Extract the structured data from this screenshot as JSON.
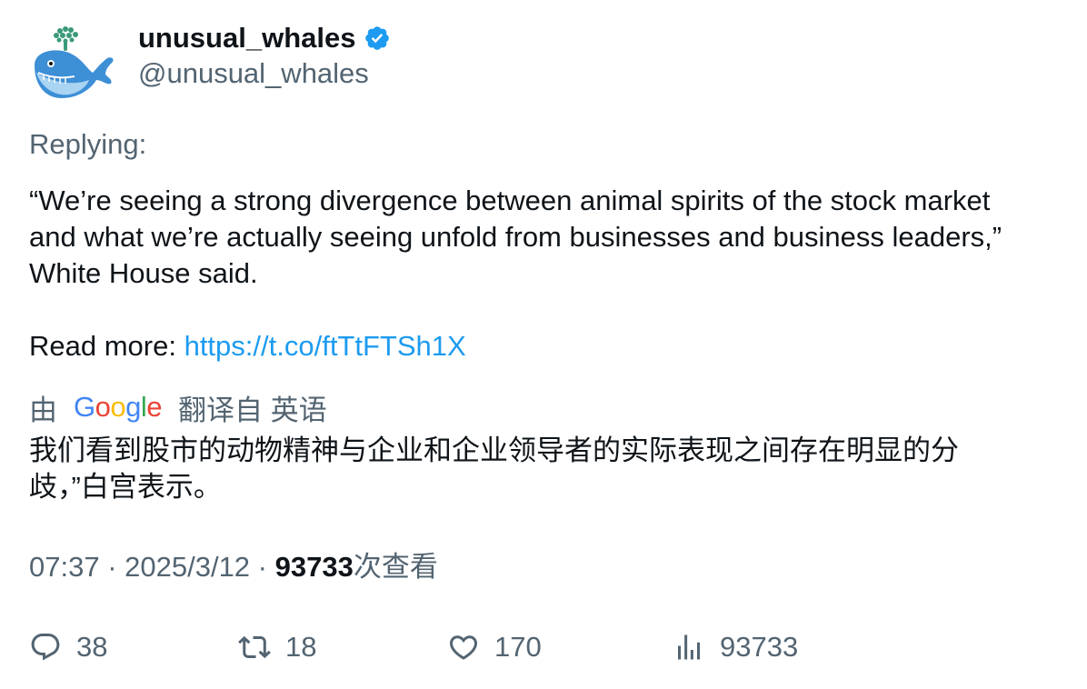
{
  "author": {
    "display_name": "unusual_whales",
    "handle": "@unusual_whales",
    "verified": true,
    "avatar_icon": "whale-avatar-icon"
  },
  "replying_label": "Replying:",
  "body": {
    "lines": [
      "“We’re seeing a strong divergence between animal spirits of the stock market",
      "and what we’re actually seeing unfold from businesses and business leaders,”",
      "White House said."
    ],
    "read_more_prefix": "Read more: ",
    "link": "https://t.co/ftTtFTSh1X"
  },
  "translation": {
    "by_label": "由",
    "provider": "Google",
    "from_label": "翻译自 英语",
    "lines": [
      "我们看到股市的动物精神与企业和企业领导者的实际表现之间存在明显的分",
      "歧，”白宫表示。"
    ]
  },
  "meta": {
    "time": "07:37",
    "separator": " · ",
    "date": "2025/3/12",
    "views_count": "93733",
    "views_label": "次查看"
  },
  "actions": {
    "replies": "38",
    "retweets": "18",
    "likes": "170",
    "views": "93733"
  },
  "colors": {
    "text_primary": "#0f1419",
    "text_secondary": "#536471",
    "link": "#1d9bf0",
    "verified": "#1d9bf0"
  }
}
